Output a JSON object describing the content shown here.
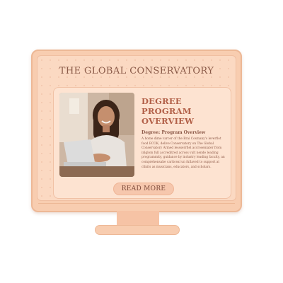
{
  "site": {
    "title": "THE GLOBAL CONSERVATORY"
  },
  "card": {
    "heading": "DEGREE PROGRAM OVERVIEW",
    "subheading": "Degree: Program Overview",
    "body": "A home dime varcer of the Brai Cosmany's leverflot food ECOK, delive Conservatory on The Global Conservatory Armed lessserrfiel accrosemater from inlglom full accreditred across vult nende leading programmity, guidance by industry leading faculty, an comprehensahe carticeal un fullaved to support at cfinits as musicians, educators, and scholars.",
    "button_label": "READ MORE",
    "image_alt": "smiling student with laptop"
  },
  "colors": {
    "monitor": "#f8cdb0",
    "screen": "#fbd9c2",
    "heading": "#b26048",
    "text": "#8d5a49"
  }
}
